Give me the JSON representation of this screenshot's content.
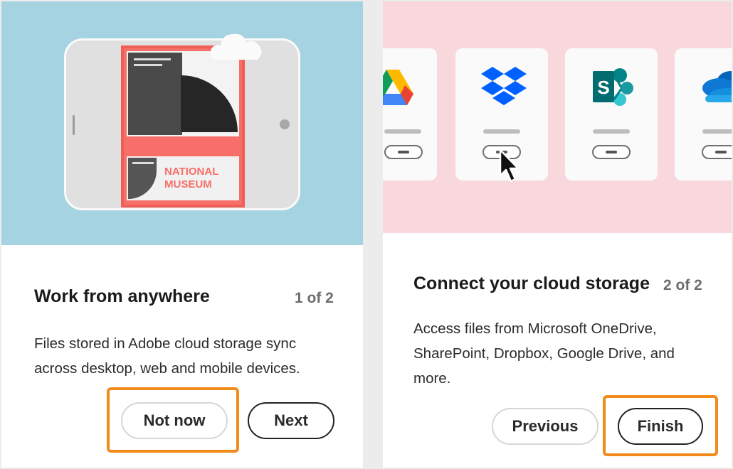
{
  "cards": [
    {
      "title": "Work from anywhere",
      "step": "1 of 2",
      "description": "Files stored in Adobe cloud storage sync across desktop, web and mobile devices.",
      "illustration": {
        "poster_text_line1": "NATIONAL",
        "poster_text_line2": "MUSEUM"
      },
      "buttons": {
        "secondary": "Not now",
        "primary": "Next"
      }
    },
    {
      "title": "Connect your cloud storage",
      "step": "2 of 2",
      "description": "Access files from Microsoft OneDrive, SharePoint, Dropbox, Google Drive, and more.",
      "services": [
        {
          "icon": "google-drive-icon"
        },
        {
          "icon": "dropbox-icon"
        },
        {
          "icon": "sharepoint-icon"
        },
        {
          "icon": "onedrive-icon"
        }
      ],
      "buttons": {
        "secondary": "Previous",
        "primary": "Finish"
      }
    }
  ],
  "colors": {
    "highlight": "#f28a1c",
    "hero_blue": "#a6d3e1",
    "hero_pink": "#f8d8dd",
    "poster_red": "#f76f68",
    "dropbox_blue": "#0061fe",
    "sharepoint_teal": "#038387",
    "onedrive_blue": "#0f63c4"
  }
}
